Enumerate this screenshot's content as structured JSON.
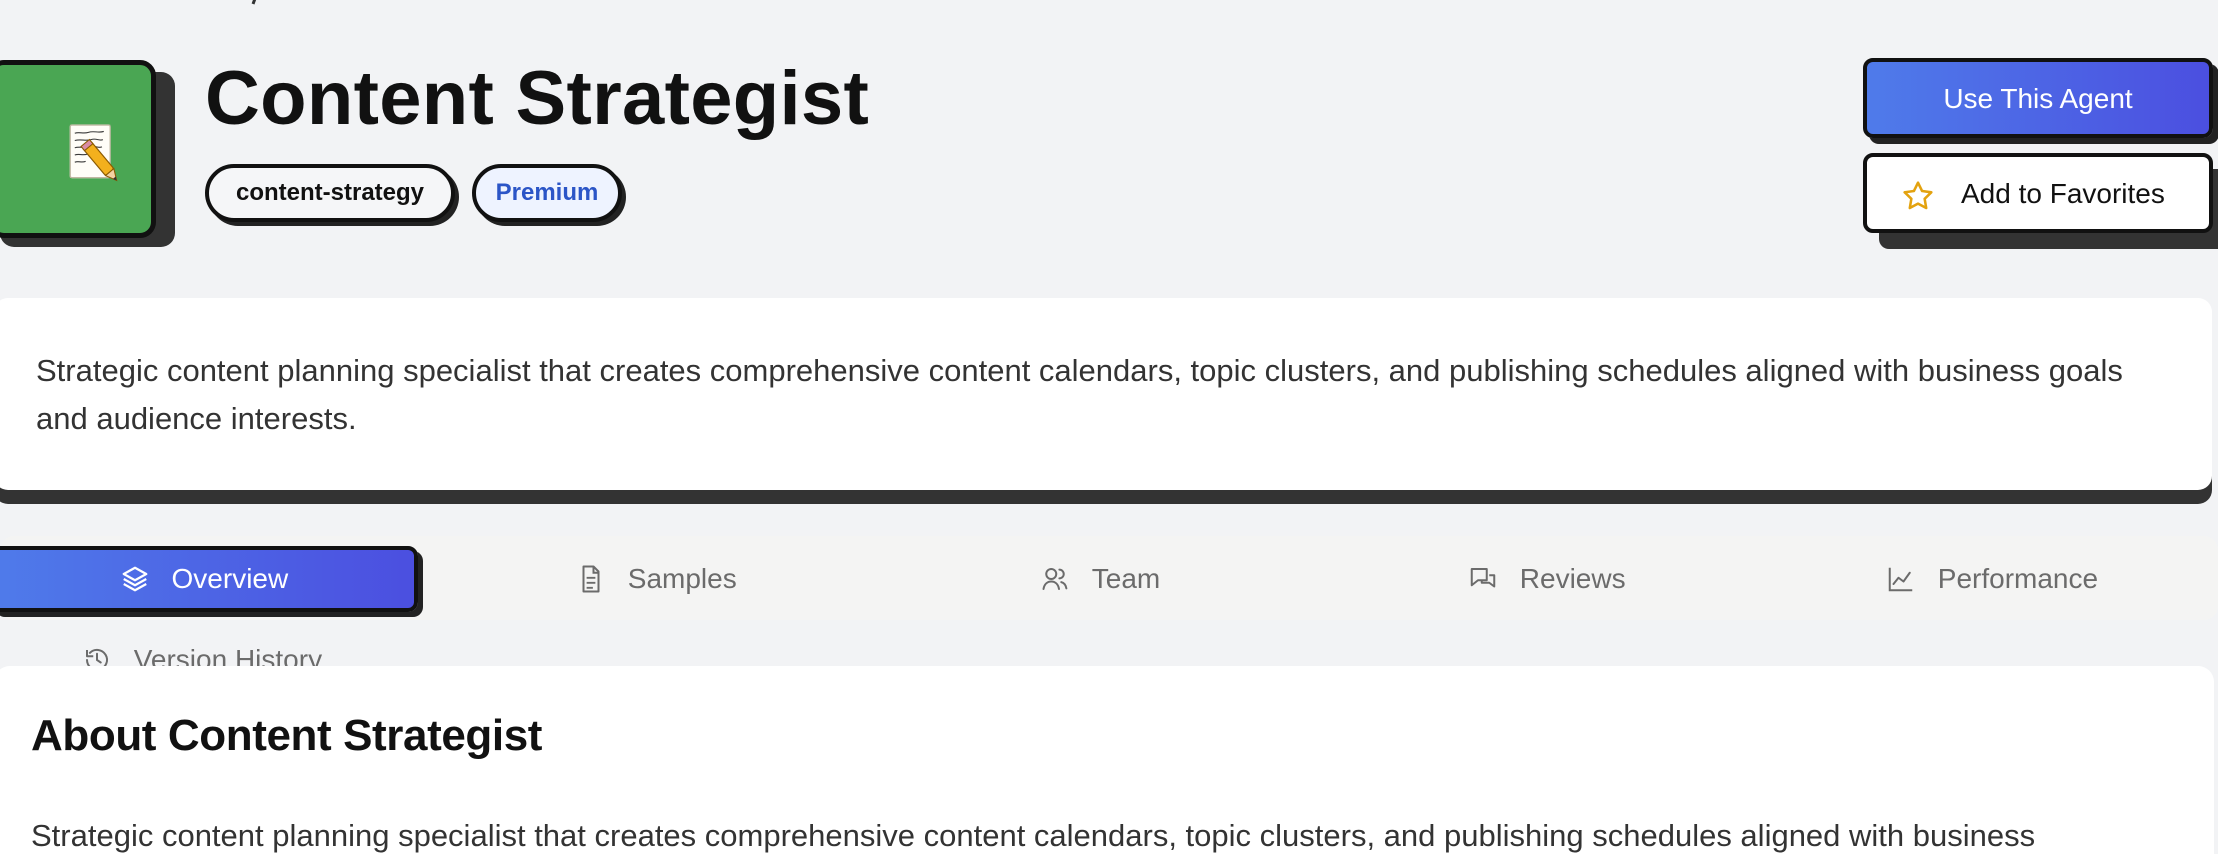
{
  "agent": {
    "title": "Content Strategist",
    "category_tag": "content-strategy",
    "plan_badge": "Premium",
    "avatar_icon": "memo-icon",
    "description": "Strategic content planning specialist that creates comprehensive content calendars, topic clusters, and publishing schedules aligned with business goals and audience interests."
  },
  "actions": {
    "use_agent": "Use This Agent",
    "add_favorites": "Add to Favorites",
    "favorite_icon": "star-icon"
  },
  "tabs": [
    {
      "label": "Overview",
      "icon": "layers-icon",
      "active": true
    },
    {
      "label": "Samples",
      "icon": "document-icon",
      "active": false
    },
    {
      "label": "Team",
      "icon": "users-icon",
      "active": false
    },
    {
      "label": "Reviews",
      "icon": "chat-icon",
      "active": false
    },
    {
      "label": "Performance",
      "icon": "chart-icon",
      "active": false
    },
    {
      "label": "Version History",
      "icon": "history-icon",
      "active": false
    }
  ],
  "about": {
    "heading": "About Content Strategist",
    "text": "Strategic content planning specialist that creates comprehensive content calendars, topic clusters, and publishing schedules aligned with business"
  },
  "colors": {
    "background": "#f2f3f5",
    "accent_start": "#4f7bea",
    "accent_end": "#4b4fe0",
    "avatar_green": "#4aa653",
    "premium_text": "#2b55c7",
    "text_muted": "#6b6b6b"
  }
}
